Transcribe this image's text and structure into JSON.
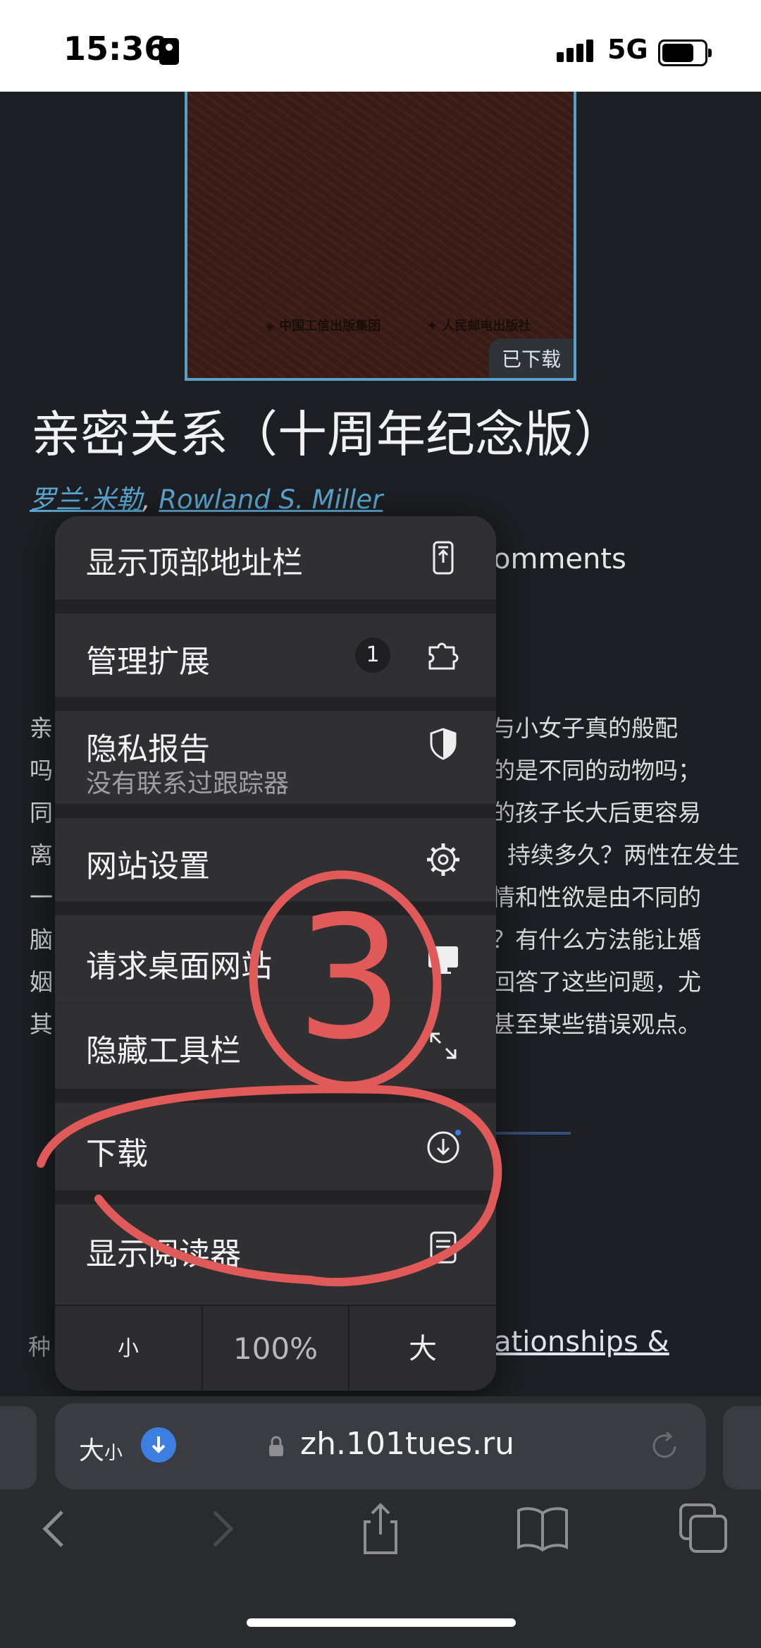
{
  "status": {
    "time": "15:36",
    "network": "5G"
  },
  "book": {
    "downloaded_badge": "已下载",
    "title": "亲密关系（十周年纪念版）",
    "authors": [
      "罗兰·米勒",
      "Rowland S. Miller"
    ],
    "comments_peek": "omments",
    "description_left": [
      "亲",
      "吗",
      "同",
      "离",
      "一",
      "脑",
      "姻",
      "其"
    ],
    "description_right": [
      "与小女子真的般配",
      "的是不同的动物吗；",
      "的孩子长大后更容易",
      "持续多久？两性在发生",
      "情和性欲是由不同的",
      "？有什么方法能让婚",
      "回答了这些问题，尤",
      "甚至某些错误观点。"
    ],
    "kind_label": "种",
    "link_peek": "lationships &"
  },
  "menu": {
    "items": [
      {
        "label": "显示顶部地址栏",
        "icon": "address-bar-top-icon"
      },
      {
        "label": "管理扩展",
        "badge": "1",
        "icon": "puzzle-piece-icon"
      },
      {
        "label": "隐私报告",
        "sub": "没有联系过跟踪器",
        "icon": "shield-icon"
      },
      {
        "label": "网站设置",
        "icon": "gear-icon"
      },
      {
        "label": "请求桌面网站",
        "icon": "desktop-icon"
      },
      {
        "label": "隐藏工具栏",
        "icon": "expand-arrows-icon"
      },
      {
        "label": "下载",
        "icon": "download-icon"
      },
      {
        "label": "显示阅读器",
        "icon": "reader-icon"
      }
    ],
    "zoom": {
      "smaller": "小",
      "level": "100%",
      "larger": "大"
    }
  },
  "toolbar": {
    "aa_label_big": "大",
    "aa_label_small": "小",
    "url": "zh.101tues.ru"
  },
  "annotation": {
    "number": "3",
    "color": "#e05a5a"
  }
}
